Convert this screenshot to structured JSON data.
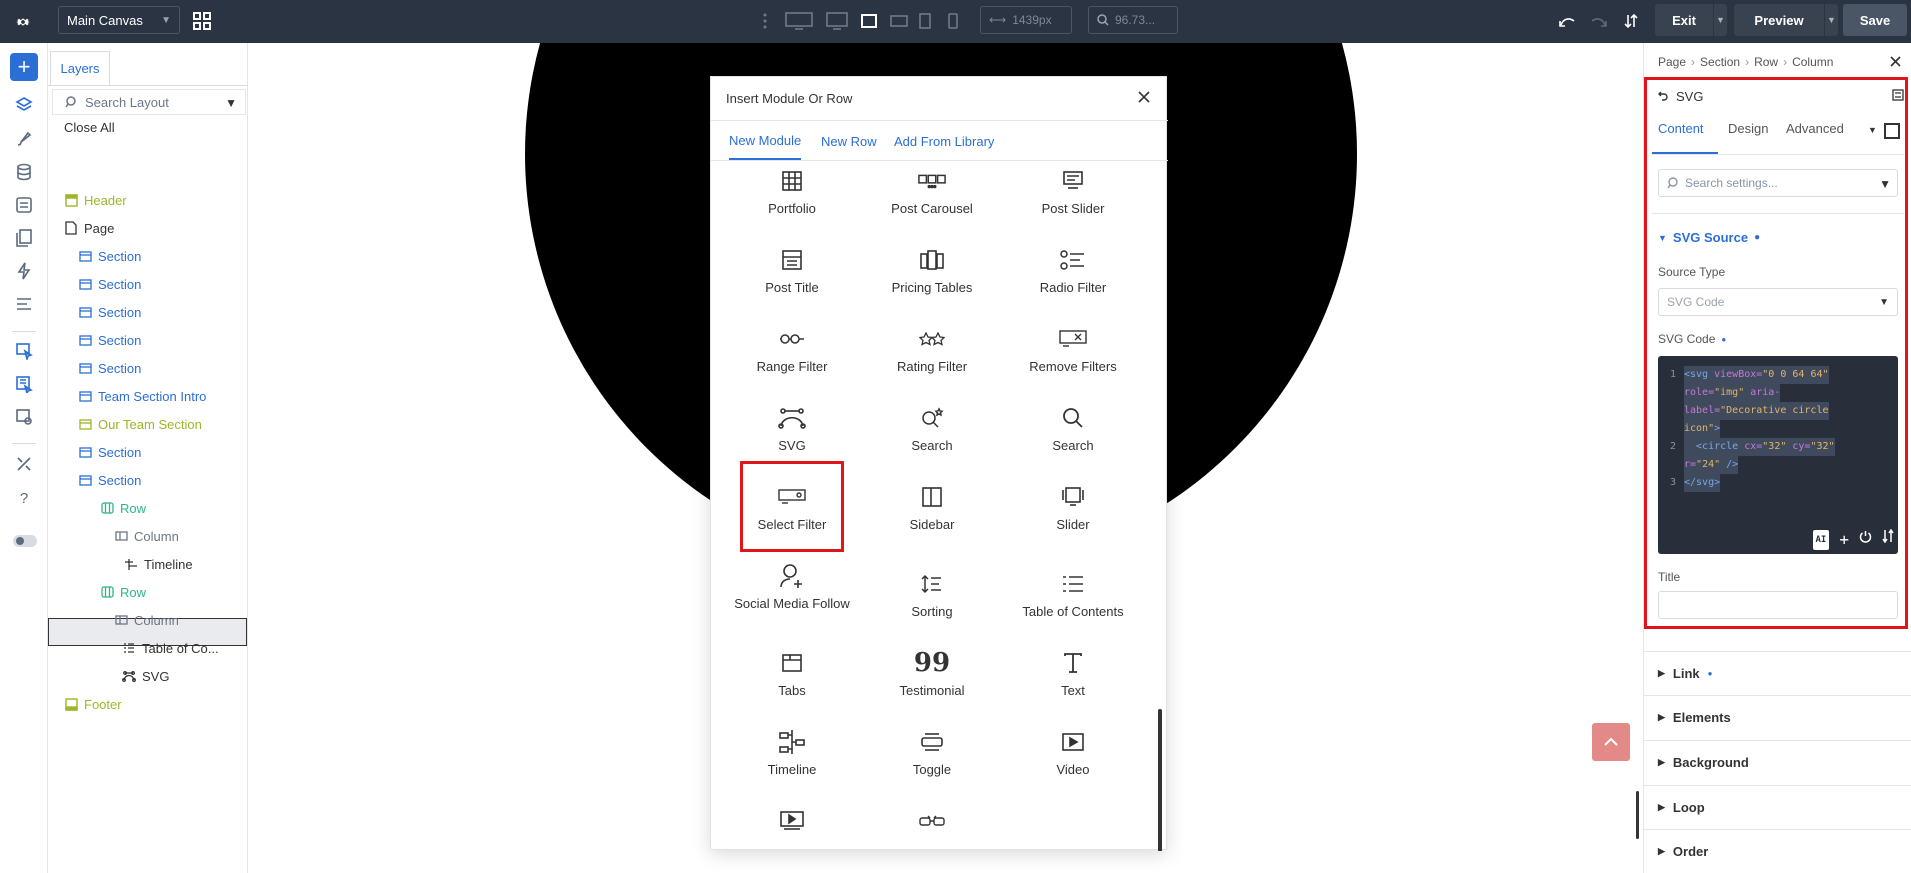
{
  "topbar": {
    "canvas_select": "Main Canvas",
    "width_value": "1439px",
    "zoom_value": "96.73...",
    "exit_label": "Exit",
    "preview_label": "Preview",
    "save_label": "Save"
  },
  "layers": {
    "tab_label": "Layers",
    "search_placeholder": "Search Layout",
    "close_all": "Close All",
    "items": [
      {
        "label": "Header"
      },
      {
        "label": "Page"
      },
      {
        "label": "Section"
      },
      {
        "label": "Section"
      },
      {
        "label": "Section"
      },
      {
        "label": "Section"
      },
      {
        "label": "Section"
      },
      {
        "label": "Team Section Intro"
      },
      {
        "label": "Our Team Section"
      },
      {
        "label": "Section"
      },
      {
        "label": "Section"
      },
      {
        "label": "Row"
      },
      {
        "label": "Column"
      },
      {
        "label": "Timeline"
      },
      {
        "label": "Row"
      },
      {
        "label": "Column"
      },
      {
        "label": "Table of Co..."
      },
      {
        "label": "SVG"
      },
      {
        "label": "Footer"
      }
    ]
  },
  "modal": {
    "title": "Insert Module Or Row",
    "tabs": [
      "New Module",
      "New Row",
      "Add From Library"
    ],
    "modules": [
      {
        "label": "Portfolio",
        "icon": "grid-icon"
      },
      {
        "label": "Post Carousel",
        "icon": "carousel-icon"
      },
      {
        "label": "Post Slider",
        "icon": "slider-post-icon"
      },
      {
        "label": "Post Title",
        "icon": "post-title-icon"
      },
      {
        "label": "Pricing Tables",
        "icon": "pricing-icon"
      },
      {
        "label": "Radio Filter",
        "icon": "radio-filter-icon"
      },
      {
        "label": "Range Filter",
        "icon": "range-filter-icon"
      },
      {
        "label": "Rating Filter",
        "icon": "rating-filter-icon"
      },
      {
        "label": "Remove Filters",
        "icon": "remove-filters-icon"
      },
      {
        "label": "SVG",
        "icon": "svg-icon"
      },
      {
        "label": "Search",
        "icon": "search-star-icon"
      },
      {
        "label": "Search",
        "icon": "search-icon"
      },
      {
        "label": "Select Filter",
        "icon": "select-filter-icon"
      },
      {
        "label": "Sidebar",
        "icon": "sidebar-icon"
      },
      {
        "label": "Slider",
        "icon": "slider-icon"
      },
      {
        "label": "Social Media Follow",
        "icon": "social-follow-icon"
      },
      {
        "label": "Sorting",
        "icon": "sorting-icon"
      },
      {
        "label": "Table of Contents",
        "icon": "toc-icon"
      },
      {
        "label": "Tabs",
        "icon": "tabs-icon"
      },
      {
        "label": "Testimonial",
        "icon": "quote-icon"
      },
      {
        "label": "Text",
        "icon": "text-icon"
      },
      {
        "label": "Timeline",
        "icon": "timeline-icon"
      },
      {
        "label": "Toggle",
        "icon": "toggle-icon"
      },
      {
        "label": "Video",
        "icon": "video-icon"
      },
      {
        "label": "",
        "icon": "video-slider-icon"
      },
      {
        "label": "",
        "icon": "glasses-icon"
      }
    ]
  },
  "settings": {
    "breadcrumb": [
      "Page",
      "Section",
      "Row",
      "Column"
    ],
    "module_name": "SVG",
    "tabs": [
      "Content",
      "Design",
      "Advanced"
    ],
    "search_placeholder": "Search settings...",
    "section_title": "SVG Source",
    "source_type_label": "Source Type",
    "source_type_value": "SVG Code",
    "svg_code_label": "SVG Code",
    "code": {
      "l1a_tag": "<svg",
      "l1a_attr": " viewBox=",
      "l1a_val": "\"0 0 64 64\"",
      "l1b_attr": "role=",
      "l1b_val": "\"img\"",
      "l1b_attr2": " aria-",
      "l1c_attr": "label=",
      "l1c_val": "\"Decorative circle",
      "l1d_val": "icon\"",
      "l1d_tag": ">",
      "l2a_tag": "  <circle",
      "l2a_attr": " cx=",
      "l2a_val": "\"32\"",
      "l2a_attr2": " cy=",
      "l2a_val2": "\"32\"",
      "l2b_attr": "r=",
      "l2b_val": "\"24\"",
      "l2b_tag": " />",
      "l3_tag": "</svg>"
    },
    "ai_label": "AI",
    "title_label": "Title",
    "accordions": [
      "Link",
      "Elements",
      "Background",
      "Loop",
      "Order"
    ]
  },
  "colors": {
    "accent": "#2b6fd6",
    "highlight": "#e0151a",
    "topbar": "#2a3443"
  }
}
